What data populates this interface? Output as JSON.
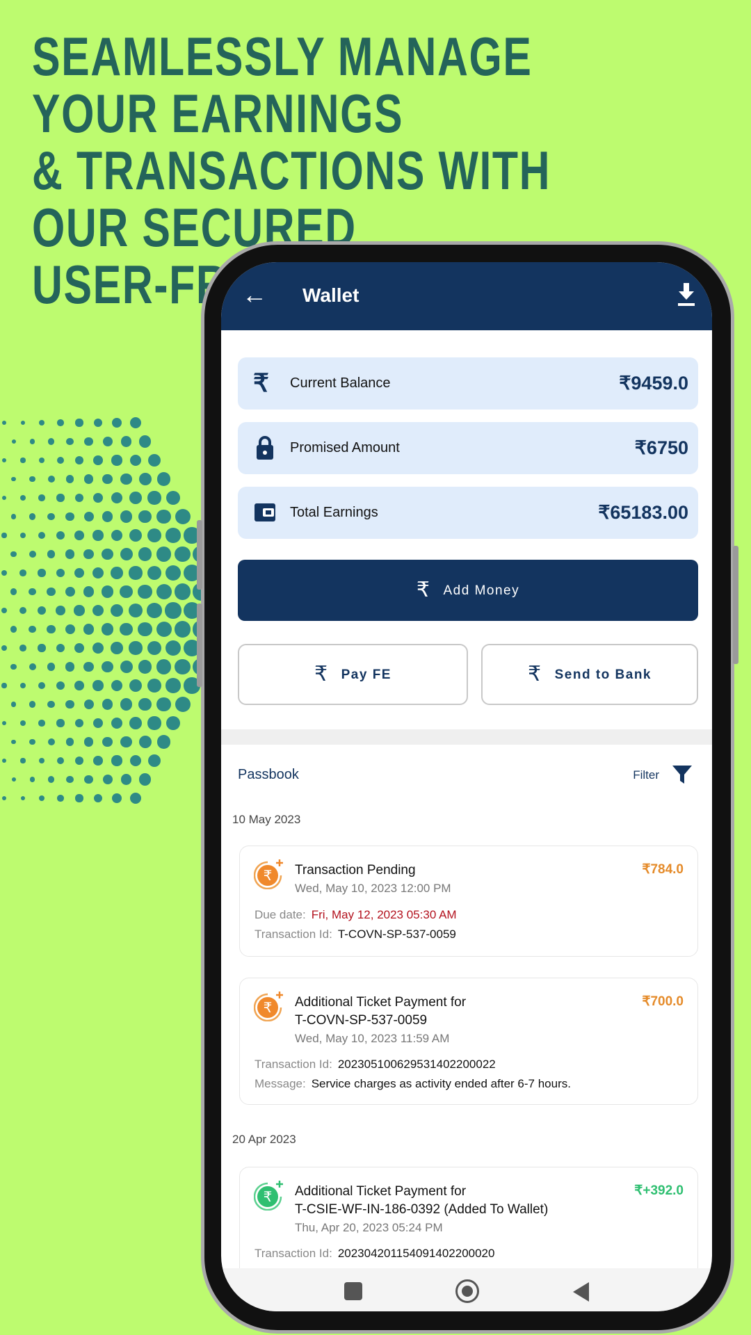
{
  "headline": [
    "Seamlessly manage your earnings",
    "& transactions with our secured",
    "user-friendly wallet"
  ],
  "colors": {
    "background": "#bdfb6f",
    "headline": "#24645a",
    "header": "#13345f",
    "card": "#e0ecfb",
    "pending": "#e58b2a",
    "due": "#b3121e",
    "credit": "#2fbf71"
  },
  "header": {
    "title": "Wallet",
    "back_icon": "arrow-left-icon",
    "action_icon": "download-icon"
  },
  "summary": [
    {
      "label": "Current Balance",
      "value": "₹9459.0",
      "icon": "rupee-icon"
    },
    {
      "label": "Promised Amount",
      "value": "₹6750",
      "icon": "lock-icon"
    },
    {
      "label": "Total Earnings",
      "value": "₹65183.00",
      "icon": "wallet-icon"
    }
  ],
  "actions": {
    "add_money": "Add Money",
    "pay_fe": "Pay FE",
    "send_to_bank": "Send to Bank",
    "rupee": "₹"
  },
  "passbook": {
    "title": "Passbook",
    "filter": "Filter"
  },
  "groups": [
    {
      "date": "10 May 2023",
      "items": [
        {
          "title": "Transaction Pending",
          "subtitle": "",
          "time": "Wed, May 10, 2023 12:00 PM",
          "amount": "₹784.0",
          "due_label": "Due date:",
          "due": "Fri, May 12, 2023 05:30 AM",
          "id_label": "Transaction Id:",
          "id": "T-COVN-SP-537-0059"
        },
        {
          "title": "Additional Ticket Payment for",
          "subtitle": "T-COVN-SP-537-0059",
          "time": "Wed, May 10, 2023 11:59 AM",
          "amount": "₹700.0",
          "id_label": "Transaction Id:",
          "id": "20230510062953140220002​2",
          "msg_label": "Message:",
          "msg": "Service charges as activity ended after 6-7 hours."
        }
      ]
    },
    {
      "date": "20 Apr 2023",
      "items": [
        {
          "title": "Additional Ticket Payment for",
          "subtitle": "T-CSIE-WF-IN-186-0392 (Added To Wallet)",
          "time": "Thu, Apr 20, 2023 05:24 PM",
          "amount": "₹+392.0",
          "id_label": "Transaction Id:",
          "id": "20230420115409140220002​0"
        }
      ]
    }
  ]
}
